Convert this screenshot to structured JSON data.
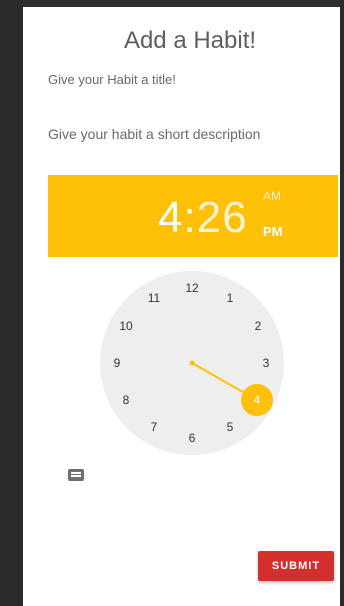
{
  "page": {
    "title": "Add a Habit!",
    "title_field_placeholder": "Give your Habit a title!",
    "description_field_placeholder": "Give your habit a short description"
  },
  "time_picker": {
    "hour": "4",
    "separator": ":",
    "minute": "26",
    "am_label": "AM",
    "pm_label": "PM",
    "selected_period": "PM",
    "selected_hour": 4,
    "accent_color": "#ffc107",
    "dial_numbers": [
      "12",
      "1",
      "2",
      "3",
      "4",
      "5",
      "6",
      "7",
      "8",
      "9",
      "10",
      "11"
    ]
  },
  "actions": {
    "keyboard_icon": "keyboard-icon",
    "submit_label": "SUBMIT",
    "submit_color": "#d32f2f"
  }
}
